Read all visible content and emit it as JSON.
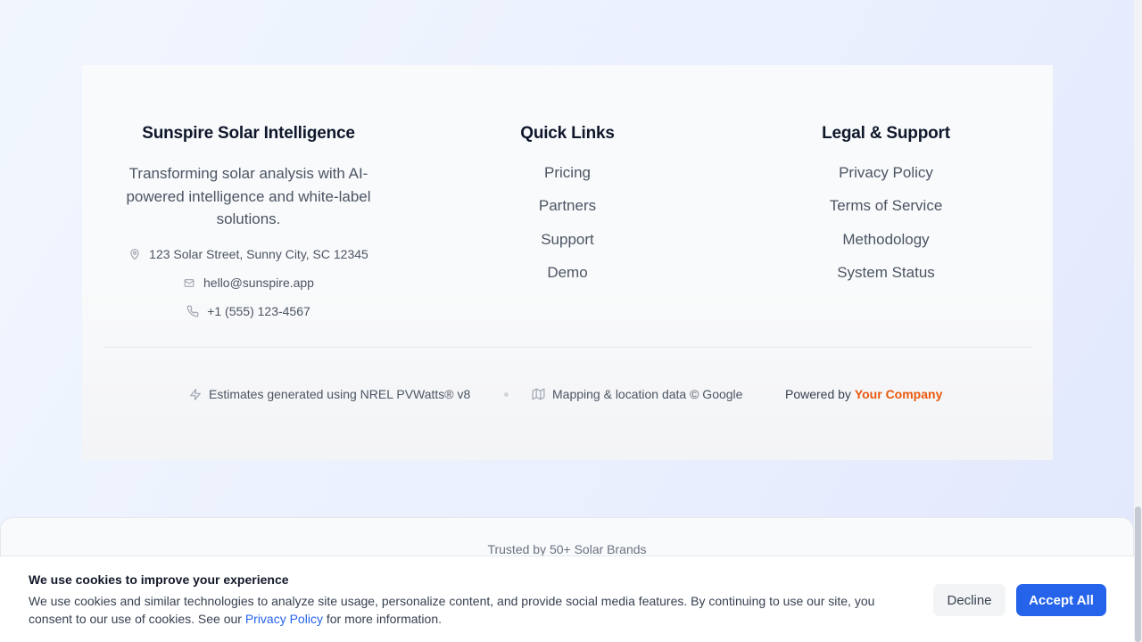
{
  "footer": {
    "brand": {
      "title": "Sunspire Solar Intelligence",
      "description": "Transforming solar analysis with AI-powered intelligence and white-label solutions.",
      "address": "123 Solar Street, Sunny City, SC 12345",
      "email": "hello@sunspire.app",
      "phone": "+1 (555) 123-4567",
      "icons": [
        "map-pin-icon",
        "mail-icon",
        "phone-icon"
      ]
    },
    "quick_links": {
      "title": "Quick Links",
      "items": [
        "Pricing",
        "Partners",
        "Support",
        "Demo"
      ]
    },
    "legal": {
      "title": "Legal & Support",
      "items": [
        "Privacy Policy",
        "Terms of Service",
        "Methodology",
        "System Status"
      ]
    },
    "attribution": {
      "estimates": "Estimates generated using NREL PVWatts® v8",
      "mapping": "Mapping & location data © Google",
      "powered_prefix": "Powered by",
      "powered_company": "Your Company",
      "icons": [
        "zap-icon",
        "map-icon"
      ]
    }
  },
  "trusted": {
    "text": "Trusted by 50+ Solar Brands"
  },
  "cookie": {
    "title": "We use cookies to improve your experience",
    "text_before": "We use cookies and similar technologies to analyze site usage, personalize content, and provide social media features. By continuing to use our site, you consent to our use of cookies. See our ",
    "link": "Privacy Policy",
    "text_after": " for more information.",
    "decline": "Decline",
    "accept": "Accept All"
  },
  "colors": {
    "accent": "#2563eb",
    "brand_orange": "#ea580c",
    "heading": "#0f172a",
    "body_text": "#4b5563"
  }
}
